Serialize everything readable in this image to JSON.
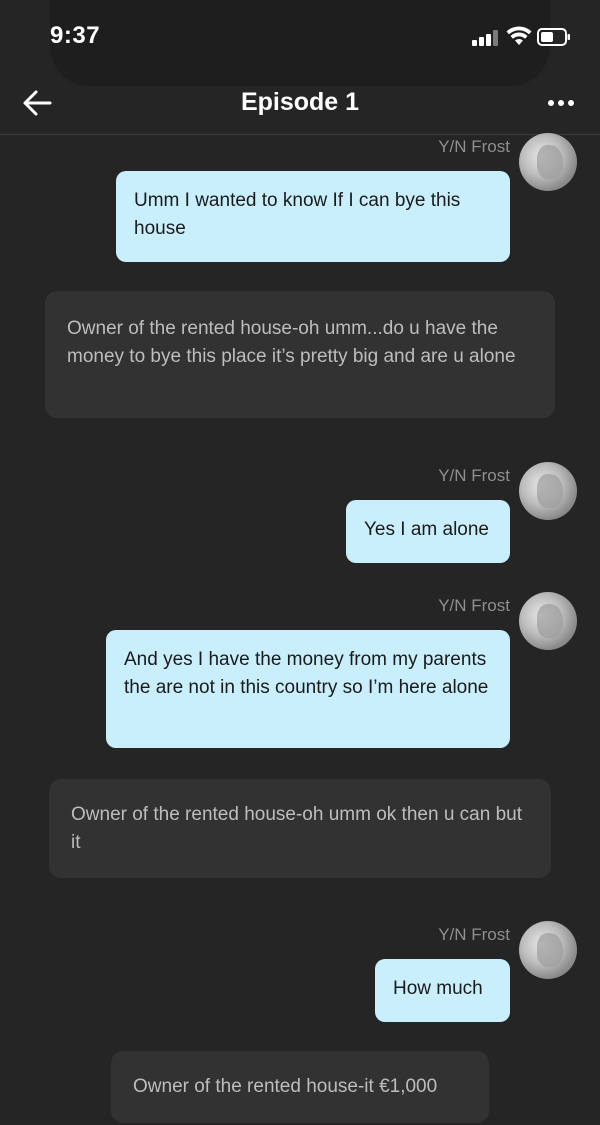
{
  "status": {
    "time": "9:37"
  },
  "nav": {
    "title": "Episode 1"
  },
  "messages": [
    {
      "type": "out",
      "sender": "Y/N Frost",
      "text": "Umm I wanted to know If I can bye this house"
    },
    {
      "type": "in",
      "text": "Owner of the rented house-oh umm...do u have the money to bye this place it’s pretty big and are u alone"
    },
    {
      "type": "out",
      "sender": "Y/N Frost",
      "text": "Yes I am alone"
    },
    {
      "type": "out",
      "sender": "Y/N Frost",
      "text": "And yes I have the money from my parents the are not in this country so I’m here alone"
    },
    {
      "type": "in",
      "text": "Owner of the rented house-oh umm ok then u can but it"
    },
    {
      "type": "out",
      "sender": "Y/N Frost",
      "text": "How much"
    },
    {
      "type": "in",
      "text": "Owner of the rented house-it €1,000"
    }
  ],
  "colors": {
    "background": "#252525",
    "outgoing_bubble": "#c9eefc",
    "incoming_bubble": "#323232"
  },
  "icons": [
    "back-arrow-icon",
    "more-options-icon",
    "signal-icon",
    "wifi-icon",
    "battery-icon"
  ]
}
